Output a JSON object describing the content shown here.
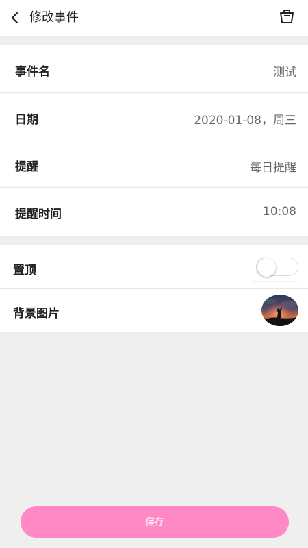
{
  "header": {
    "back_icon": "chevron-left-icon",
    "title": "修改事件",
    "delete_icon": "trash-icon"
  },
  "event": {
    "name_label": "事件名",
    "name_value": "测试",
    "date_label": "日期",
    "date_value": "2020-01-08，周三",
    "reminder_label": "提醒",
    "reminder_value": "每日提醒",
    "reminder_time_label": "提醒时间",
    "reminder_time_value": "10:08"
  },
  "options": {
    "pin_label": "置顶",
    "pin_enabled": false,
    "background_label": "背景图片",
    "background_thumb": "sunset-silhouette-image"
  },
  "footer": {
    "save_label": "保存",
    "save_color": "#fe89c4"
  }
}
